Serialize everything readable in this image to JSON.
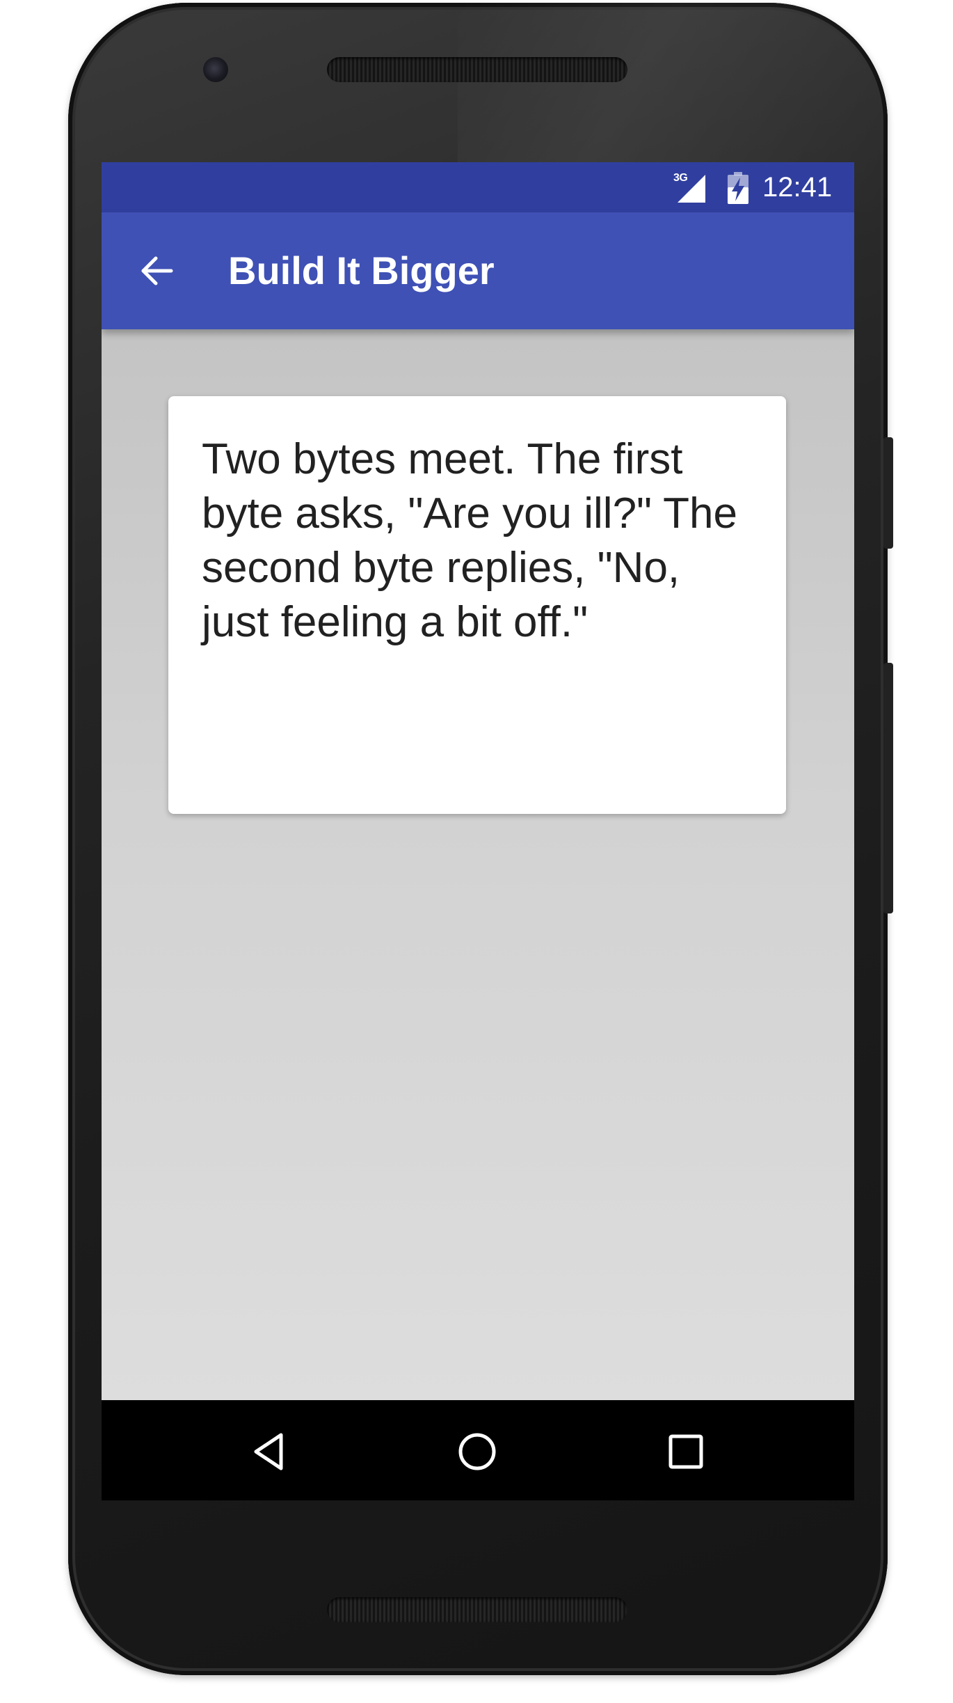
{
  "status_bar": {
    "network": "3G",
    "time": "12:41",
    "icons": [
      "signal-icon",
      "battery-charging-icon"
    ]
  },
  "app_bar": {
    "title": "Build It Bigger",
    "nav_icon": "arrow-back-icon"
  },
  "joke": {
    "text": "Two bytes meet. The first byte asks, \"Are you ill?\" The second byte replies, \"No, just feeling a bit off.\""
  },
  "nav_bar": {
    "buttons": [
      "back-triangle-icon",
      "home-circle-icon",
      "recents-square-icon"
    ]
  },
  "colors": {
    "status_bar": "#303f9f",
    "app_bar": "#3f51b5",
    "content_background": "#cfcfcf",
    "card_background": "#ffffff",
    "text": "#212121"
  }
}
